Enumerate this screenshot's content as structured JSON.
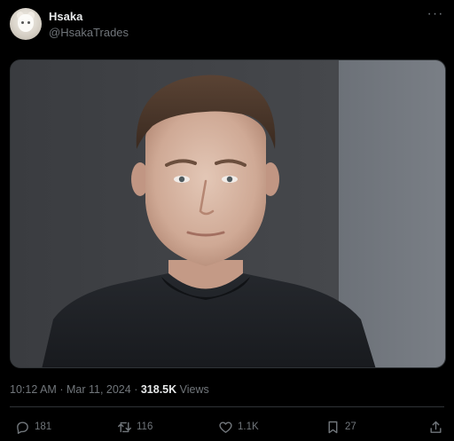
{
  "author": {
    "display_name": "Hsaka",
    "handle": "@HsakaTrades",
    "avatar_icon": "wolf-avatar-icon"
  },
  "menu_icon": "more-horizontal-icon",
  "media": {
    "type": "photo"
  },
  "meta": {
    "time": "10:12 AM",
    "separator": "·",
    "date": "Mar 11, 2024",
    "dot": "·",
    "views_count": "318.5K",
    "views_label": "Views"
  },
  "actions": {
    "replies": "181",
    "reposts": "116",
    "likes": "1.1K",
    "bookmarks": "27"
  },
  "colors": {
    "background": "#000000",
    "text_primary": "#e7e9ea",
    "text_secondary": "#71767b",
    "border": "#2f3336"
  }
}
